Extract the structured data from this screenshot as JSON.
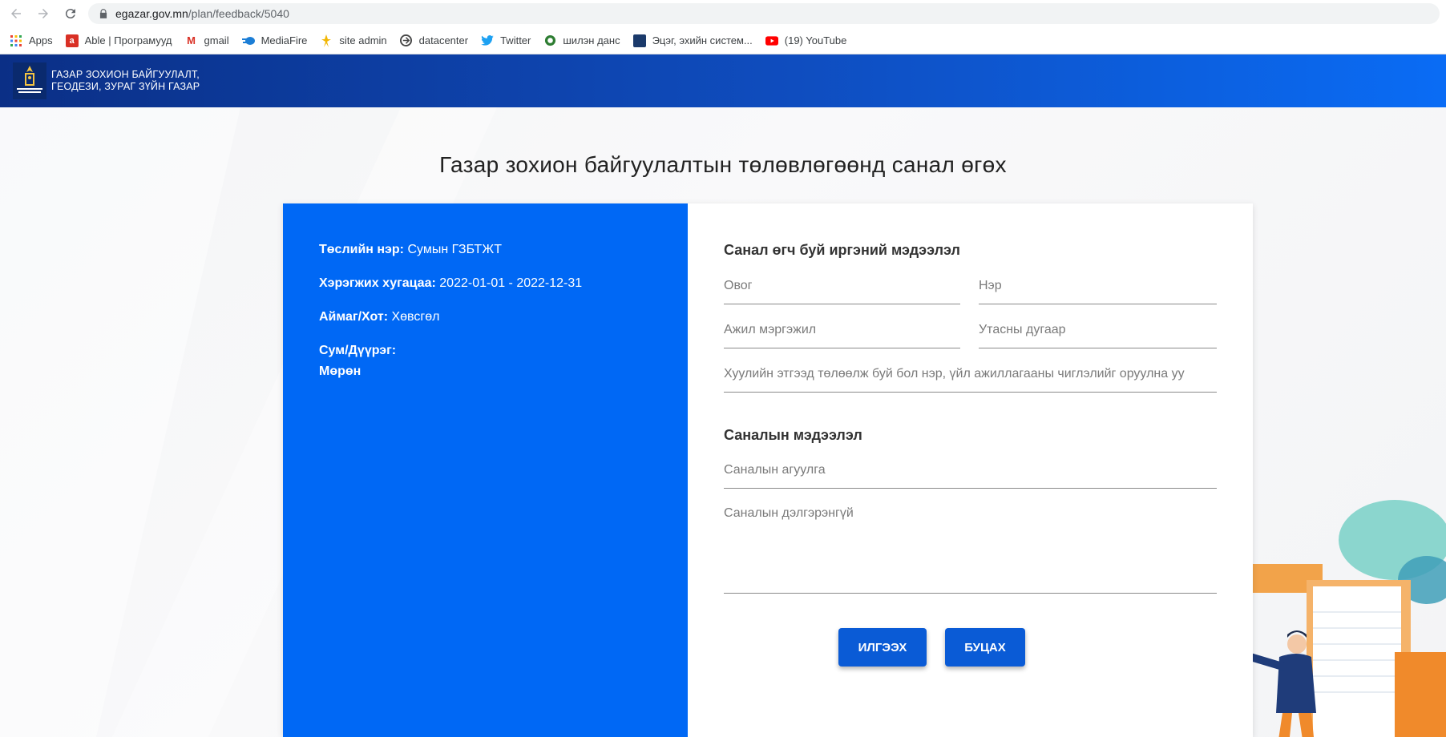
{
  "browser": {
    "url_host": "egazar.gov.mn",
    "url_path": "/plan/feedback/5040",
    "bookmarks": [
      {
        "label": "Apps",
        "icon": "apps-grid-icon"
      },
      {
        "label": "Able | Програмууд",
        "icon": "able-icon"
      },
      {
        "label": "gmail",
        "icon": "gmail-icon"
      },
      {
        "label": "MediaFire",
        "icon": "mediafire-icon"
      },
      {
        "label": "site admin",
        "icon": "site-admin-icon"
      },
      {
        "label": "datacenter",
        "icon": "datacenter-icon"
      },
      {
        "label": "Twitter",
        "icon": "twitter-icon"
      },
      {
        "label": "шилэн данс",
        "icon": "shilen-dans-icon"
      },
      {
        "label": "Эцэг, эхийн систем...",
        "icon": "parents-system-icon"
      },
      {
        "label": "(19) YouTube",
        "icon": "youtube-icon"
      }
    ]
  },
  "header": {
    "brand_line1": "ГАЗАР ЗОХИОН БАЙГУУЛАЛТ,",
    "brand_line2": "ГЕОДЕЗИ, ЗУРАГ ЗҮЙН ГАЗАР"
  },
  "page": {
    "title": "Газар зохион байгуулалтын төлөвлөгөөнд санал өгөх"
  },
  "info": {
    "project_label": "Төслийн нэр:",
    "project_value": "Сумын ГЗБТЖТ",
    "period_label": "Хэрэгжих хугацаа:",
    "period_value": "2022-01-01 - 2022-12-31",
    "aimag_label": "Аймаг/Хот:",
    "aimag_value": "Хөвсгөл",
    "sum_label": "Сум/Дүүрэг:",
    "sum_value": "Мөрөн"
  },
  "form": {
    "citizen_section": "Санал өгч буй иргэний мэдээлэл",
    "lastname_placeholder": "Овог",
    "firstname_placeholder": "Нэр",
    "profession_placeholder": "Ажил мэргэжил",
    "phone_placeholder": "Утасны дугаар",
    "entity_placeholder": "Хуулийн этгээд төлөөлж буй бол нэр, үйл ажиллагааны чиглэлийг оруулна уу",
    "feedback_section": "Саналын мэдээлэл",
    "content_placeholder": "Саналын агуулга",
    "detail_placeholder": "Саналын дэлгэрэнгүй",
    "submit_label": "ИЛГЭЭХ",
    "back_label": "БУЦАХ"
  },
  "colors": {
    "info_panel": "#0068f5",
    "header_start": "#0b2f86",
    "header_end": "#0a6cf5",
    "button": "#0a5bd6"
  }
}
